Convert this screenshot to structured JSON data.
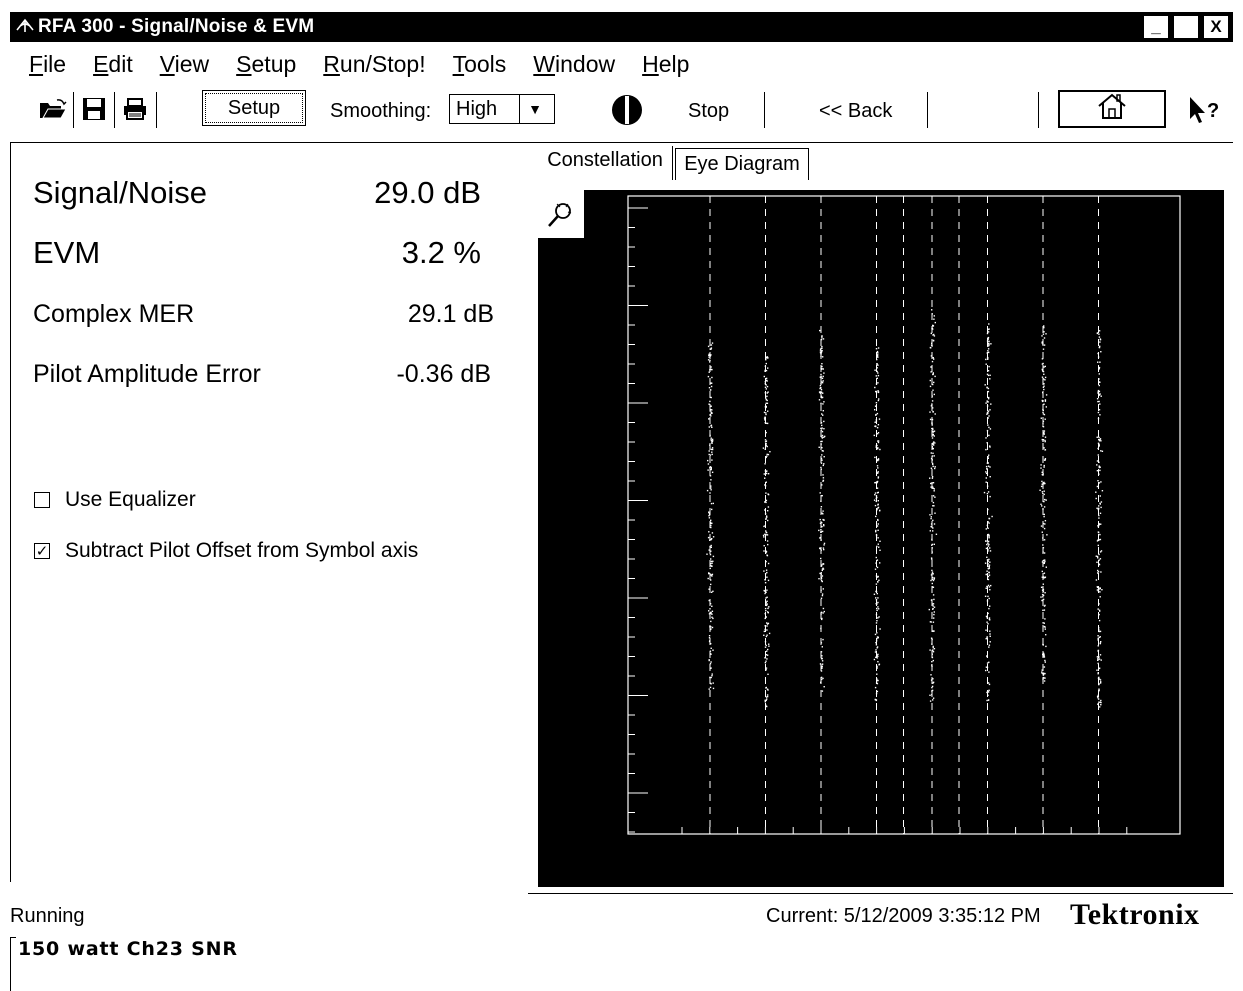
{
  "window": {
    "title": "RFA 300 - Signal/Noise & EVM",
    "app_icon": "antenna-icon",
    "controls": {
      "minimize": "_",
      "restore": "",
      "close": "X"
    }
  },
  "menu": {
    "items": [
      {
        "label": "File",
        "hotkey": "F",
        "rest": "ile"
      },
      {
        "label": "Edit",
        "hotkey": "E",
        "rest": "dit"
      },
      {
        "label": "View",
        "hotkey": "V",
        "rest": "iew"
      },
      {
        "label": "Setup",
        "hotkey": "S",
        "rest": "etup"
      },
      {
        "label": "Run/Stop!",
        "hotkey": "R",
        "rest": "un/Stop!"
      },
      {
        "label": "Tools",
        "hotkey": "T",
        "rest": "ools"
      },
      {
        "label": "Window",
        "hotkey": "W",
        "rest": "indow"
      },
      {
        "label": "Help",
        "hotkey": "H",
        "rest": "elp"
      }
    ]
  },
  "toolbar": {
    "open_icon": "folder-open-icon",
    "save_icon": "floppy-disk-icon",
    "print_icon": "printer-icon",
    "setup_label": "Setup",
    "smoothing_label": "Smoothing:",
    "smoothing_value": "High",
    "stop_label": "Stop",
    "back_label": "<< Back",
    "home_icon": "house-icon",
    "help_icon": "help-cursor-icon"
  },
  "measurements": {
    "snr_label": "Signal/Noise",
    "snr_value": "29.0 dB",
    "evm_label": "EVM",
    "evm_value": "3.2 %",
    "mer_label": "Complex MER",
    "mer_value": "29.1 dB",
    "pilot_label": "Pilot Amplitude Error",
    "pilot_value": "-0.36 dB"
  },
  "options": {
    "equalizer_label": "Use Equalizer",
    "equalizer_checked": false,
    "pilot_offset_label": "Subtract Pilot Offset from Symbol axis",
    "pilot_offset_checked": true
  },
  "tabs": {
    "constellation": "Constellation",
    "eye_diagram": "Eye Diagram",
    "active": "constellation"
  },
  "plot": {
    "background": "#000000",
    "foreground": "#ffffff",
    "zoom_icon": "magnifier-icon",
    "symbol_columns": 8,
    "noise_spread": 0.032
  },
  "status": {
    "state": "Running",
    "current": "Current: 5/12/2009 3:35:12 PM",
    "brand": "Tektronix",
    "footer": "150 watt Ch23 SNR"
  }
}
